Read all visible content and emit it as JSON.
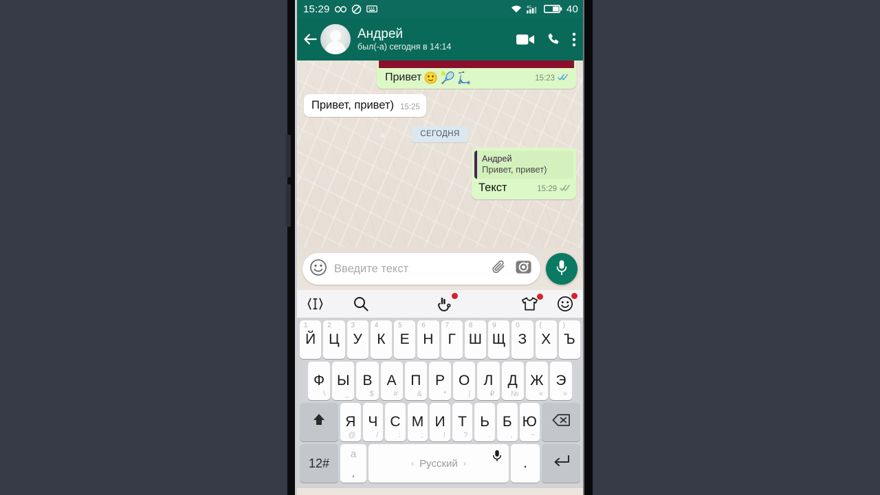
{
  "status_bar": {
    "time": "15:29",
    "battery_percent": "40",
    "icons": [
      "infinity-icon",
      "do-not-disturb-icon",
      "keyboard-icon",
      "wifi-icon",
      "signal-4g-icon",
      "battery-icon"
    ]
  },
  "chat_header": {
    "contact_name": "Андрей",
    "last_seen": "был(-а) сегодня в 14:14",
    "actions": [
      "video-call-icon",
      "voice-call-icon",
      "overflow-menu-icon"
    ]
  },
  "messages": [
    {
      "id": "image-message",
      "direction": "outgoing",
      "has_image": true,
      "caption": "Привет",
      "emojis": [
        "🙂",
        "🎾",
        "🛴"
      ],
      "time": "15:23",
      "status": "read"
    },
    {
      "id": "incoming-greeting",
      "direction": "incoming",
      "text": "Привет, привет)",
      "time": "15:25"
    },
    {
      "id": "date-divider",
      "divider_label": "СЕГОДНЯ"
    },
    {
      "id": "reply-message",
      "direction": "outgoing",
      "quote_author": "Андрей",
      "quote_text": "Привет, привет)",
      "text": "Текст",
      "time": "15:29",
      "status": "read"
    }
  ],
  "input_bar": {
    "placeholder": "Введите текст",
    "emoji_button": "emoji-smiley-icon",
    "attach_button": "paperclip-icon",
    "camera_button": "camera-icon",
    "mic_button": "microphone-icon"
  },
  "keyboard": {
    "toolbar": [
      "cursor-control-icon",
      "search-icon",
      "gesture-hand-icon",
      "tshirt-theme-icon",
      "emoji-icon"
    ],
    "rows": [
      [
        {
          "label": "Й",
          "sup": "1"
        },
        {
          "label": "Ц",
          "sup": "2"
        },
        {
          "label": "У",
          "sup": "3"
        },
        {
          "label": "К",
          "sup": "4"
        },
        {
          "label": "Е",
          "sup": "5"
        },
        {
          "label": "Н",
          "sup": "6"
        },
        {
          "label": "Г",
          "sup": "7"
        },
        {
          "label": "Ш",
          "sup": "8"
        },
        {
          "label": "Щ",
          "sup": "9"
        },
        {
          "label": "З",
          "sup": "0"
        },
        {
          "label": "Х",
          "sup": "("
        },
        {
          "label": "Ъ",
          "sup": ")"
        }
      ],
      [
        {
          "label": "Ф",
          "sub": "\\"
        },
        {
          "label": "Ы",
          "sub": "_"
        },
        {
          "label": "В",
          "sub": "$"
        },
        {
          "label": "А",
          "sub": "#"
        },
        {
          "label": "П",
          "sub": "&"
        },
        {
          "label": "Р",
          "sub": "*"
        },
        {
          "label": "О",
          "sub": "|"
        },
        {
          "label": "Л",
          "sub": "₽"
        },
        {
          "label": "Д",
          "sub": "№"
        },
        {
          "label": "Ж",
          "sub": "«"
        },
        {
          "label": "Э",
          "sub": "»"
        }
      ],
      [
        {
          "label": "Я",
          "sub": "@"
        },
        {
          "label": "Ч",
          "sub": "/"
        },
        {
          "label": "С",
          "sub": ":"
        },
        {
          "label": "М",
          "sub": ";"
        },
        {
          "label": "И",
          "sub": "!"
        },
        {
          "label": "Т",
          "sub": "?"
        },
        {
          "label": "Ь",
          "sub": "."
        },
        {
          "label": "Б",
          "sub": ","
        },
        {
          "label": "Ю",
          "sub": "~"
        }
      ]
    ],
    "shift_key": "shift-icon",
    "backspace_key": "backspace-icon",
    "numeric_key": "12#",
    "autocorrect_top": "а",
    "autocorrect_bottom": ",",
    "space_label": "Русский",
    "space_arrow_left": "‹",
    "space_arrow_right": "›",
    "space_mic": "microphone-icon",
    "period_key": ".",
    "enter_key": "enter-icon"
  },
  "colors": {
    "whatsapp_teal": "#0a6a5a",
    "status_teal": "#0d6b5e",
    "outgoing_bubble": "#dcf8c6",
    "incoming_bubble": "#ffffff",
    "chat_bg": "#e9e1d8",
    "read_receipt_blue": "#4fa8e0",
    "mic_green": "#0a7a62",
    "quote_bar": "#4a235a",
    "image_red": "#8c0f2d",
    "date_pill": "#dbe8f0",
    "notification_dot": "#d8222a",
    "page_bg": "#363b47"
  }
}
